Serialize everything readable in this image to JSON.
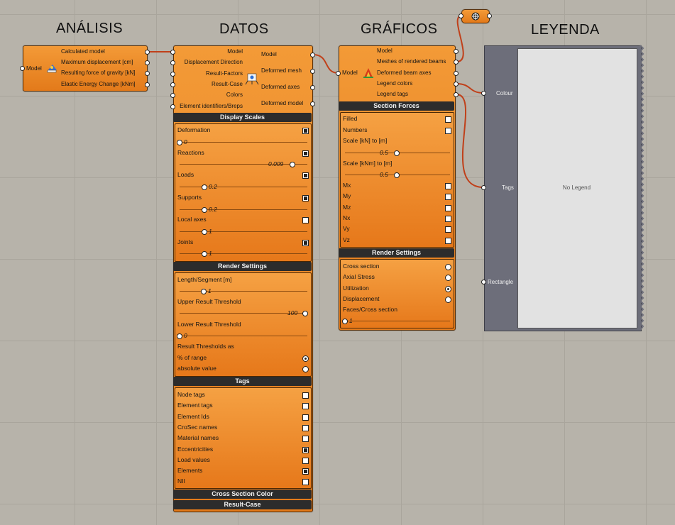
{
  "headings": {
    "analisis": "ANÁLISIS",
    "datos": "DATOS",
    "graficos": "GRÁFICOS",
    "leyenda": "LEYENDA"
  },
  "analysis": {
    "input": "Model",
    "outputs": [
      "Calculated model",
      "Maximum displacement [cm]",
      "Resulting force of gravity [kN]",
      "Elastic Energy Change [kNm]"
    ]
  },
  "datos": {
    "inputs": [
      "Model",
      "Displacement Direction",
      "Result-Factors",
      "Result-Case",
      "Colors",
      "Element identifiers/Breps"
    ],
    "outputs": [
      "Model",
      "Deformed mesh",
      "Deformed axes",
      "Deformed model"
    ],
    "display_scales": {
      "title": "Display Scales",
      "deformation": "Deformation",
      "deformation_value": "0",
      "reactions": "Reactions",
      "reactions_value": "0.009",
      "loads": "Loads",
      "loads_value": "0.2",
      "supports": "Supports",
      "supports_value": "0.2",
      "local_axes": "Local axes",
      "local_axes_value": "1",
      "joints": "Joints",
      "joints_value": "1"
    },
    "render_settings": {
      "title": "Render Settings",
      "length_segment": "Length/Segment [m]",
      "length_value": "1",
      "upper": "Upper Result Threshold",
      "upper_value": "100",
      "lower": "Lower Result Threshold",
      "lower_value": "0",
      "thresholds_as": "Result Thresholds as",
      "pct_range": "% of range",
      "absolute": "absolute value"
    },
    "tags": {
      "title": "Tags",
      "items": [
        "Node tags",
        "Element tags",
        "Element Ids",
        "CroSec names",
        "Material names",
        "Eccentricities",
        "Load values",
        "Elements",
        "NII"
      ],
      "checked": [
        false,
        false,
        false,
        false,
        false,
        true,
        false,
        true,
        false
      ]
    },
    "cross_section_color": "Cross Section Color",
    "result_case": "Result-Case"
  },
  "graficos": {
    "input": "Model",
    "outputs": [
      "Model",
      "Meshes of rendered beams",
      "Deformed beam axes",
      "Legend colors",
      "Legend tags"
    ],
    "section_forces": {
      "title": "Section Forces",
      "filled": "Filled",
      "numbers": "Numbers",
      "scale_kn": "Scale [kN] to [m]",
      "scale_kn_value": "0.5",
      "scale_knm": "Scale [kNm] to [m]",
      "scale_knm_value": "0.5",
      "forces": [
        "Mx",
        "My",
        "Mz",
        "Nx",
        "Vy",
        "Vz"
      ]
    },
    "render_settings": {
      "title": "Render Settings",
      "options": [
        "Cross section",
        "Axial Stress",
        "Utilization",
        "Displacement"
      ],
      "selected": "Utilization",
      "faces": "Faces/Cross section",
      "faces_value": "1"
    }
  },
  "legend": {
    "inputs": [
      "Colour",
      "Tags",
      "Rectangle"
    ],
    "empty_text": "No Legend"
  }
}
